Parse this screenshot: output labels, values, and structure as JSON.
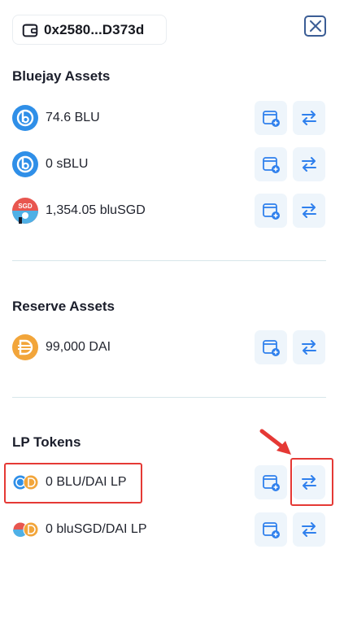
{
  "wallet": {
    "address": "0x2580...D373d"
  },
  "sections": {
    "bluejay": {
      "title": "Bluejay Assets",
      "items": [
        {
          "label": "74.6 BLU",
          "icon": "blu-token-icon"
        },
        {
          "label": "0 sBLU",
          "icon": "sblu-token-icon"
        },
        {
          "label": "1,354.05 bluSGD",
          "icon": "blusgd-token-icon"
        }
      ]
    },
    "reserve": {
      "title": "Reserve Assets",
      "items": [
        {
          "label": "99,000 DAI",
          "icon": "dai-token-icon"
        }
      ]
    },
    "lp": {
      "title": "LP Tokens",
      "items": [
        {
          "label": "0 BLU/DAI LP",
          "icon": "blu-dai-lp-icon"
        },
        {
          "label": "0 bluSGD/DAI LP",
          "icon": "blusgd-dai-lp-icon"
        }
      ]
    }
  },
  "actions": {
    "add_icon": "add-to-wallet-icon",
    "swap_icon": "swap-arrows-icon"
  },
  "colors": {
    "accent": "#2f80ed",
    "button_bg": "#eef5fb",
    "highlight": "#e53935",
    "blu": "#2f8fe8",
    "dai": "#f2a53a",
    "close": "#3b5d95"
  }
}
